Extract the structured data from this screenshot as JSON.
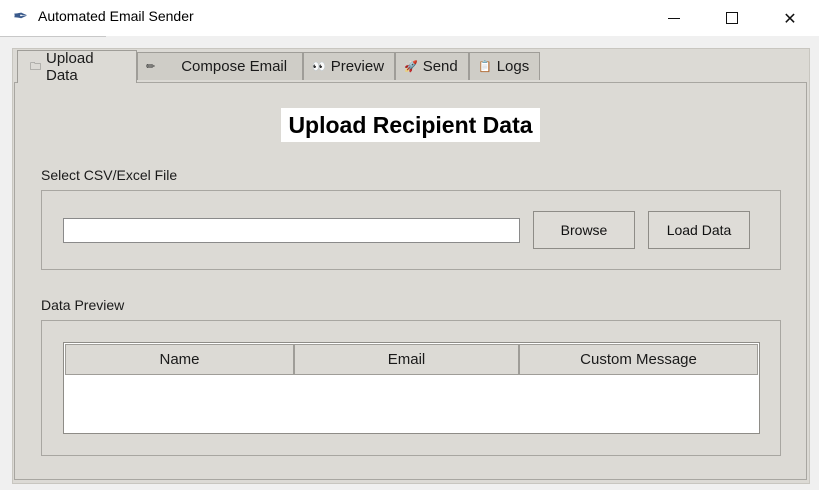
{
  "window": {
    "title": "Automated Email Sender",
    "icon": "feather-icon"
  },
  "tabs": [
    {
      "icon": "🗀",
      "label": "Upload Data",
      "active": true
    },
    {
      "icon": "✏",
      "label": "Compose Email",
      "active": false
    },
    {
      "icon": "👀",
      "label": "Preview",
      "active": false
    },
    {
      "icon": "🚀",
      "label": "Send",
      "active": false
    },
    {
      "icon": "📋",
      "label": "Logs",
      "active": false
    }
  ],
  "upload": {
    "heading": "Upload Recipient Data",
    "file_section_label": "Select CSV/Excel File",
    "file_path_value": "",
    "browse_label": "Browse",
    "load_label": "Load Data",
    "preview_section_label": "Data Preview",
    "columns": [
      "Name",
      "Email",
      "Custom Message"
    ],
    "rows": []
  },
  "colors": {
    "panel_bg": "#dcdad5",
    "title_bg": "#ffffff"
  }
}
